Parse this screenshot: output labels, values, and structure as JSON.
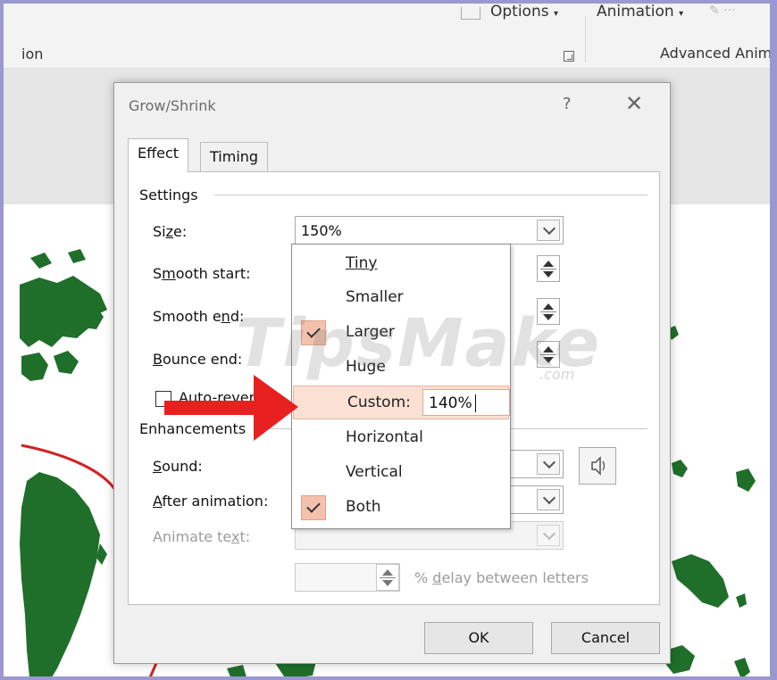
{
  "ribbon": {
    "options_label": "Options",
    "animation_label": "Animation",
    "group_left": "ion",
    "group_right": "Advanced Anim"
  },
  "dialog": {
    "title": "Grow/Shrink",
    "help_glyph": "?",
    "close_glyph": "✕",
    "tabs": [
      "Effect",
      "Timing"
    ],
    "settings": {
      "group_label": "Settings",
      "size_label": "Size:",
      "size_value": "150%",
      "smooth_start_label": "Smooth start:",
      "smooth_end_label": "Smooth end:",
      "bounce_end_label": "Bounce end:",
      "auto_reverse_label": "Auto-reverse"
    },
    "enhancements": {
      "group_label": "Enhancements",
      "sound_label": "Sound:",
      "after_animation_label": "After animation:",
      "animate_text_label": "Animate text:",
      "delay_label": "% delay between letters",
      "sound_icon": "speaker-icon"
    },
    "buttons": {
      "ok": "OK",
      "cancel": "Cancel"
    }
  },
  "size_dropdown": {
    "items": [
      {
        "label": "Tiny",
        "checked": false
      },
      {
        "label": "Smaller",
        "checked": false
      },
      {
        "label": "Larger",
        "checked": true
      },
      {
        "label": "Huge",
        "checked": false
      },
      {
        "label": "Custom:",
        "checked": false
      },
      {
        "label": "Horizontal",
        "checked": false
      },
      {
        "label": "Vertical",
        "checked": false
      },
      {
        "label": "Both",
        "checked": true
      }
    ],
    "custom_value": "140%"
  },
  "watermark": {
    "text": "TipsMake",
    "suffix": ".com"
  },
  "colors": {
    "check_bg": "#f3c1ad",
    "highlight_bg": "#fbe0d4",
    "arrow": "#e8201f",
    "map_green": "#1f6f2a",
    "frame_border": "#9b98cf"
  }
}
